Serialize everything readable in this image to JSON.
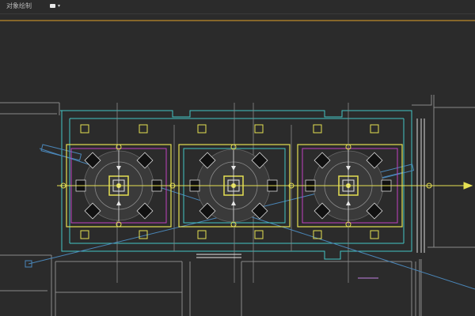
{
  "toolbar": {
    "title": "对象绘制",
    "view_button_icon": "camera-icon",
    "view_dropdown_icon": "chevron-down-icon"
  },
  "viewport": {
    "drawing": "cad-ceiling-plan",
    "colors": {
      "background": "#2b2b2b",
      "wall": "#8c8c8c",
      "cyan": "#43c4c4",
      "yellow": "#e5e052",
      "magenta": "#c040c0",
      "white": "#e6e6e6",
      "blue_dim": "#4a86b8",
      "orange": "#e2a12a"
    }
  }
}
